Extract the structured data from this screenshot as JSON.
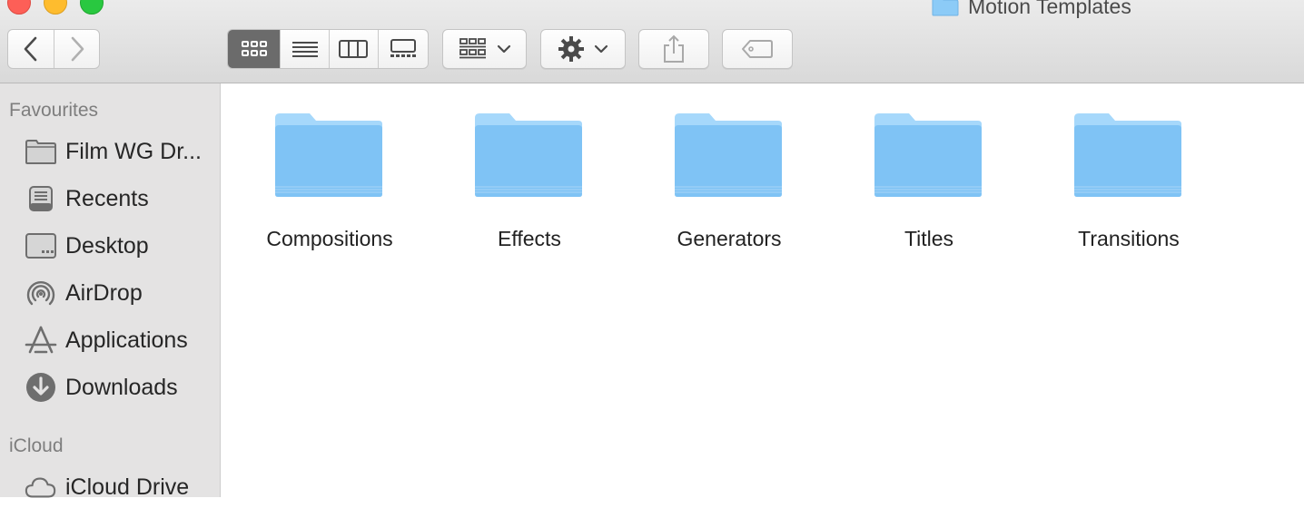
{
  "window": {
    "title": "Motion Templates"
  },
  "toolbar": {
    "back_icon": "chevron-left-icon",
    "forward_icon": "chevron-right-icon",
    "view_modes": [
      "icon-view-icon",
      "list-view-icon",
      "column-view-icon",
      "gallery-view-icon"
    ],
    "active_view": "icon-view-icon",
    "group_icon": "group-by-icon",
    "action_icon": "gear-icon",
    "share_icon": "share-icon",
    "tag_icon": "tag-icon"
  },
  "sidebar": {
    "favourites_title": "Favourites",
    "items": [
      {
        "label": "Film WG Dr...",
        "icon": "drive-folder-icon"
      },
      {
        "label": "Recents",
        "icon": "recents-icon"
      },
      {
        "label": "Desktop",
        "icon": "desktop-icon"
      },
      {
        "label": "AirDrop",
        "icon": "airdrop-icon"
      },
      {
        "label": "Applications",
        "icon": "applications-icon"
      },
      {
        "label": "Downloads",
        "icon": "downloads-icon"
      }
    ],
    "icloud_title": "iCloud",
    "icloud_items": [
      {
        "label": "iCloud Drive",
        "icon": "cloud-icon"
      }
    ]
  },
  "content": {
    "folders": [
      {
        "name": "Compositions"
      },
      {
        "name": "Effects"
      },
      {
        "name": "Generators"
      },
      {
        "name": "Titles"
      },
      {
        "name": "Transitions"
      }
    ]
  },
  "colors": {
    "folder_light": "#9fd5fb",
    "folder_main": "#7cc2f5",
    "sidebar_bg": "#e4e3e3",
    "active_segment": "#6b6b6b"
  }
}
